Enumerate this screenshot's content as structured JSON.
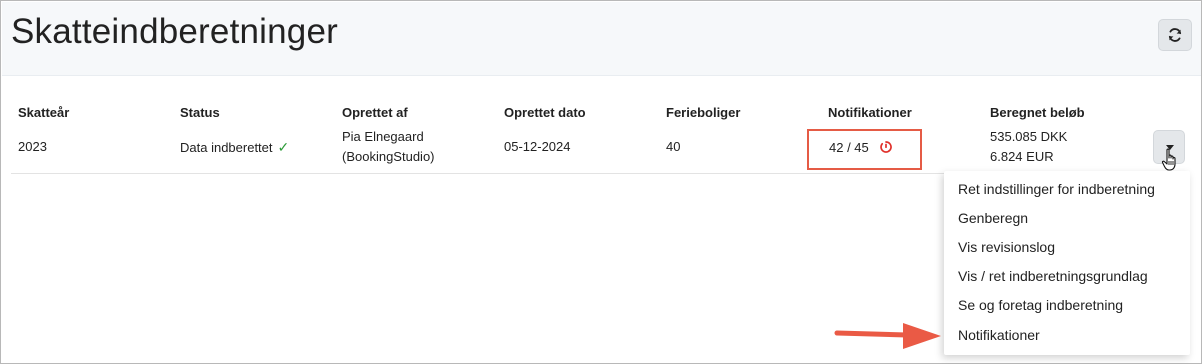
{
  "header": {
    "title": "Skatteindberetninger",
    "refresh_icon": "refresh-icon"
  },
  "table": {
    "columns": [
      "Skatteår",
      "Status",
      "Oprettet af",
      "Oprettet dato",
      "Ferieboliger",
      "Notifikationer",
      "Beregnet beløb"
    ],
    "row": {
      "year": "2023",
      "status": "Data indberettet",
      "status_icon": "check-icon",
      "created_by_line1": "Pia Elnegaard",
      "created_by_line2": "(BookingStudio)",
      "created_date": "05-12-2024",
      "holiday_homes": "40",
      "notifications": "42 / 45",
      "notifications_icon": "pending-notification-icon",
      "amount_dkk": "535.085 DKK",
      "amount_eur": "6.824 EUR"
    }
  },
  "menu": {
    "items": [
      "Ret indstillinger for indberetning",
      "Genberegn",
      "Vis revisionslog",
      "Vis / ret indberetningsgrundlag",
      "Se og foretag indberetning",
      "Notifikationer"
    ]
  },
  "colors": {
    "highlight": "#e55b45",
    "check": "#2e9c3a",
    "header_bg": "#f6f8fa"
  }
}
